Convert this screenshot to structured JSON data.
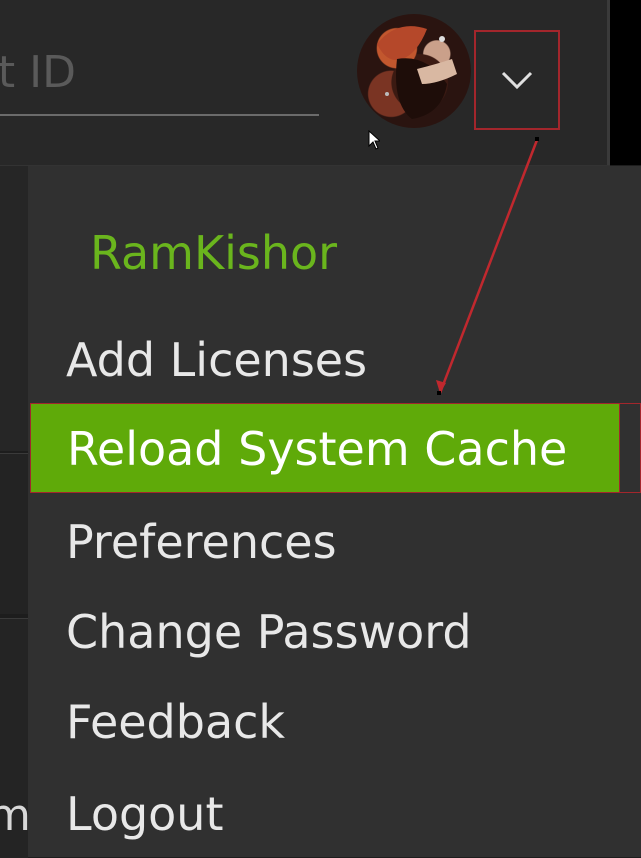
{
  "header": {
    "search_placeholder": "nt ID",
    "avatar_icon": "user-avatar",
    "dropdown_icon": "chevron-down-icon"
  },
  "left_cut_text": "m",
  "menu": {
    "user_name": "RamKishor",
    "items": [
      {
        "label": "Add Licenses"
      },
      {
        "label": "Reload System Cache",
        "active": true
      },
      {
        "label": "Preferences"
      },
      {
        "label": "Change Password"
      },
      {
        "label": "Feedback"
      },
      {
        "label": "Logout"
      }
    ]
  },
  "colors": {
    "accent_green": "#5faa09",
    "user_name_green": "#6ab51d",
    "highlight_red": "#a3262c",
    "menu_bg": "#303030"
  }
}
